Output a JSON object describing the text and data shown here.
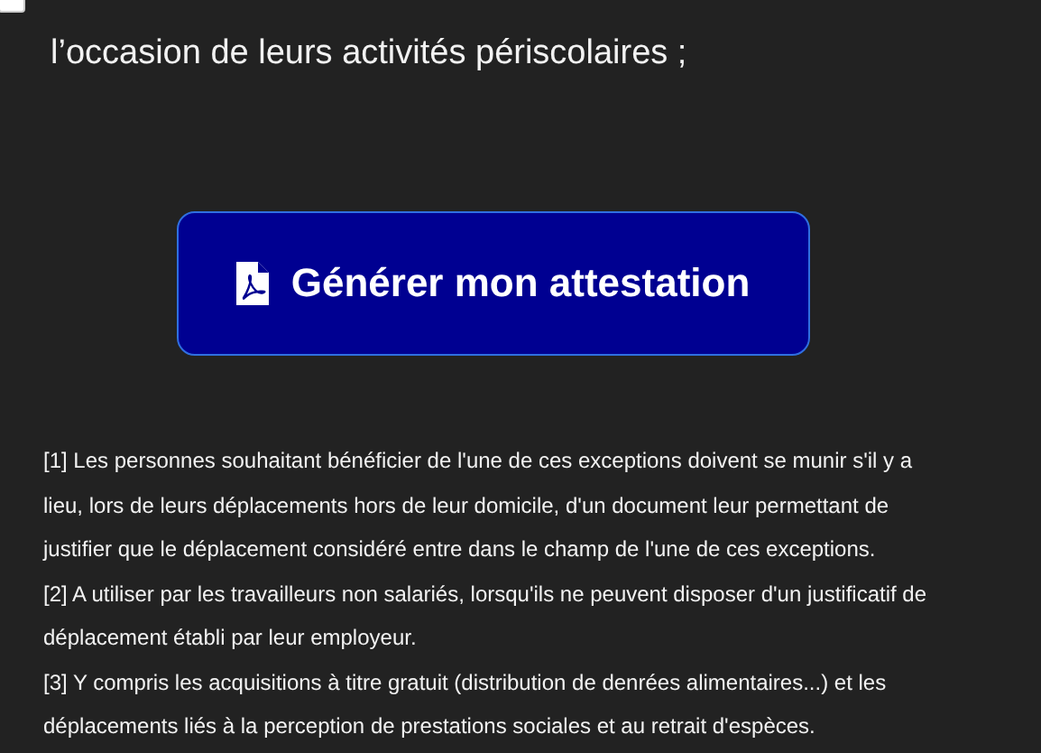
{
  "option": {
    "label": "l’occasion de leurs activités périscolaires ;",
    "checked": false
  },
  "button": {
    "label": "Générer mon attestation"
  },
  "footnotes": [
    "[1] Les personnes souhaitant bénéficier de l'une de ces exceptions doivent se munir s'il y a lieu, lors de leurs déplacements hors de leur domicile, d'un document leur permettant de justifier que le déplacement considéré entre dans le champ de l'une de ces exceptions.",
    "[2] A utiliser par les travailleurs non salariés, lorsqu'ils ne peuvent disposer d'un justificatif de déplacement établi par leur employeur.",
    "[3] Y compris les acquisitions à titre gratuit (distribution de denrées alimentaires...) et les déplacements liés à la perception de prestations sociales et au retrait d'espèces."
  ]
}
